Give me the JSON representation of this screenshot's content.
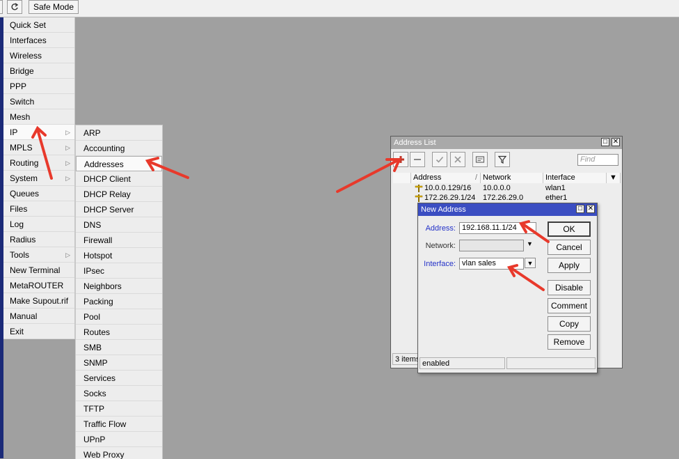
{
  "toolbar": {
    "safe_mode_label": "Safe Mode"
  },
  "menu": {
    "items": [
      "Quick Set",
      "Interfaces",
      "Wireless",
      "Bridge",
      "PPP",
      "Switch",
      "Mesh",
      "IP",
      "MPLS",
      "Routing",
      "System",
      "Queues",
      "Files",
      "Log",
      "Radius",
      "Tools",
      "New Terminal",
      "MetaROUTER",
      "Make Supout.rif",
      "Manual",
      "Exit"
    ]
  },
  "ip_submenu": {
    "items": [
      "ARP",
      "Accounting",
      "Addresses",
      "DHCP Client",
      "DHCP Relay",
      "DHCP Server",
      "DNS",
      "Firewall",
      "Hotspot",
      "IPsec",
      "Neighbors",
      "Packing",
      "Pool",
      "Routes",
      "SMB",
      "SNMP",
      "Services",
      "Socks",
      "TFTP",
      "Traffic Flow",
      "UPnP",
      "Web Proxy"
    ]
  },
  "address_list": {
    "title": "Address List",
    "find_placeholder": "Find",
    "columns": {
      "address": "Address",
      "network": "Network",
      "interface": "Interface"
    },
    "rows": [
      {
        "address": "10.0.0.129/16",
        "network": "10.0.0.0",
        "interface": "wlan1"
      },
      {
        "address": "172.26.29.1/24",
        "network": "172.26.29.0",
        "interface": "ether1"
      }
    ],
    "status": "3 items"
  },
  "new_address": {
    "title": "New Address",
    "address_label": "Address:",
    "address_value": "192.168.11.1/24",
    "network_label": "Network:",
    "network_value": "",
    "interface_label": "Interface:",
    "interface_value": "vlan sales",
    "buttons": {
      "ok": "OK",
      "cancel": "Cancel",
      "apply": "Apply",
      "disable": "Disable",
      "comment": "Comment",
      "copy": "Copy",
      "remove": "Remove"
    },
    "status": "enabled"
  },
  "colors": {
    "accent_title": "#3b4ec2",
    "annotation_arrow": "#e8392b",
    "add_icon": "#c0392b",
    "sidebar_strip": "#1b2a78"
  }
}
